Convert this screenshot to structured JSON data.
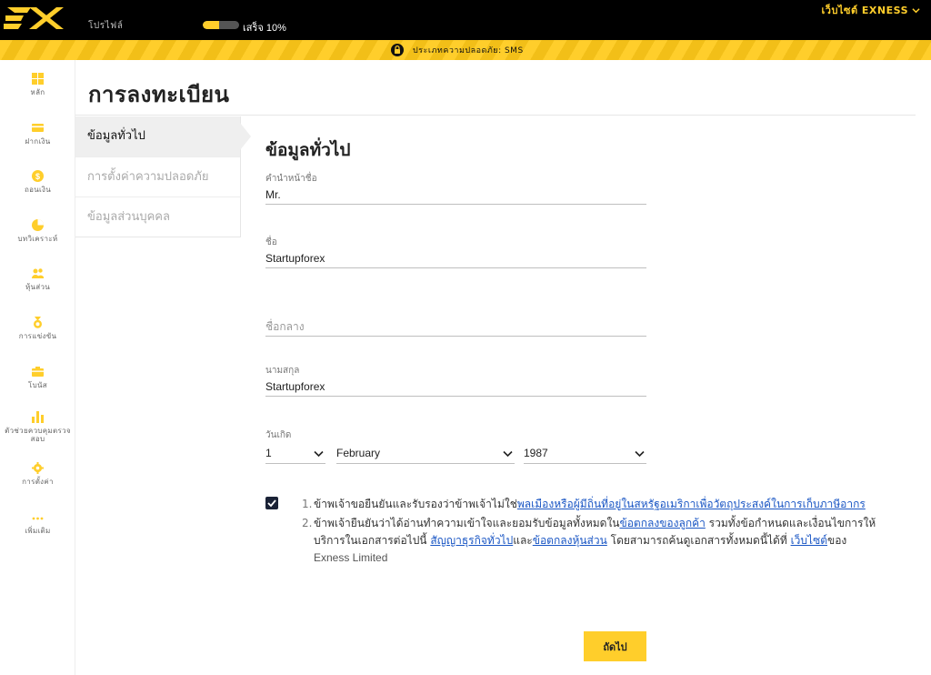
{
  "header": {
    "profile_label": "โปรไฟล์",
    "progress_text": "เสร็จ 10%",
    "progress_fraction": 0.45,
    "website_menu": "เว็บไซต์ EXNESS",
    "security_text": "ประเภทความปลอดภัย: SMS",
    "brand_color": "#ffce2b"
  },
  "sidebar": {
    "items": [
      {
        "label": "หลัก",
        "icon": "grid-icon"
      },
      {
        "label": "ฝากเงิน",
        "icon": "card-icon"
      },
      {
        "label": "ถอนเงิน",
        "icon": "coin-icon"
      },
      {
        "label": "บทวิเคราะห์",
        "icon": "pie-chart-icon"
      },
      {
        "label": "หุ้นส่วน",
        "icon": "partners-icon"
      },
      {
        "label": "การแข่งขัน",
        "icon": "medal-icon"
      },
      {
        "label": "โบนัส",
        "icon": "gift-icon"
      },
      {
        "label": "ตัวช่วยควบคุมตรวจสอบ",
        "icon": "bar-chart-icon"
      },
      {
        "label": "การตั้งค่า",
        "icon": "gear-icon"
      },
      {
        "label": "เพิ่มเติม",
        "icon": "more-icon"
      }
    ]
  },
  "main": {
    "page_title": "การลงทะเบียน",
    "steps": [
      {
        "label": "ข้อมูลทั่วไป",
        "active": true
      },
      {
        "label": "การตั้งค่าความปลอดภัย",
        "active": false
      },
      {
        "label": "ข้อมูลส่วนบุคคล",
        "active": false
      }
    ],
    "section_title": "ข้อมูลทั่วไป",
    "form": {
      "title_label": "คำนำหน้าชื่อ",
      "title_value": "Mr.",
      "first_name_label": "ชื่อ",
      "first_name_value": "Startupforex",
      "middle_name_placeholder": "ชื่อกลาง",
      "last_name_label": "นามสกุล",
      "last_name_value": "Startupforex",
      "birth_label": "วันเกิด",
      "birth_day": "1",
      "birth_month": "February",
      "birth_year": "1987"
    },
    "terms": {
      "checked": true,
      "t1_num": "1.",
      "t1_prefix": "ข้าพเจ้าขอยืนยันและรับรองว่าข้าพเจ้าไม่ใช่",
      "t1_link": "พลเมืองหรือผู้มีถิ่นที่อยู่ในสหรัฐอเมริกาเพื่อวัตถุประสงค์ในการเก็บภาษีอากร",
      "t2_num": "2.",
      "t2_prefix": "ข้าพเจ้ายืนยันว่าได้อ่านทำความเข้าใจและยอมรับข้อมูลทั้งหมดใน",
      "t2_link1": "ข้อตกลงของลูกค้า",
      "t2_mid1": " รวมทั้งข้อกำหนดและเงื่อนไขการให้บริการในเอกสารต่อไปนี้ ",
      "t2_link2": "สัญญาธุรกิจทั่วไป",
      "t2_mid2": "และ",
      "t2_link3": "ข้อตกลงหุ้นส่วน",
      "t2_mid3": " โดยสามารถค้นดูเอกสารทั้งหมดนี้ได้ที่ ",
      "t2_link4": "เว็บไซต์",
      "t2_mid4": "ของ ",
      "t2_company": "Exness Limited"
    },
    "next_button": "ถัดไป"
  }
}
